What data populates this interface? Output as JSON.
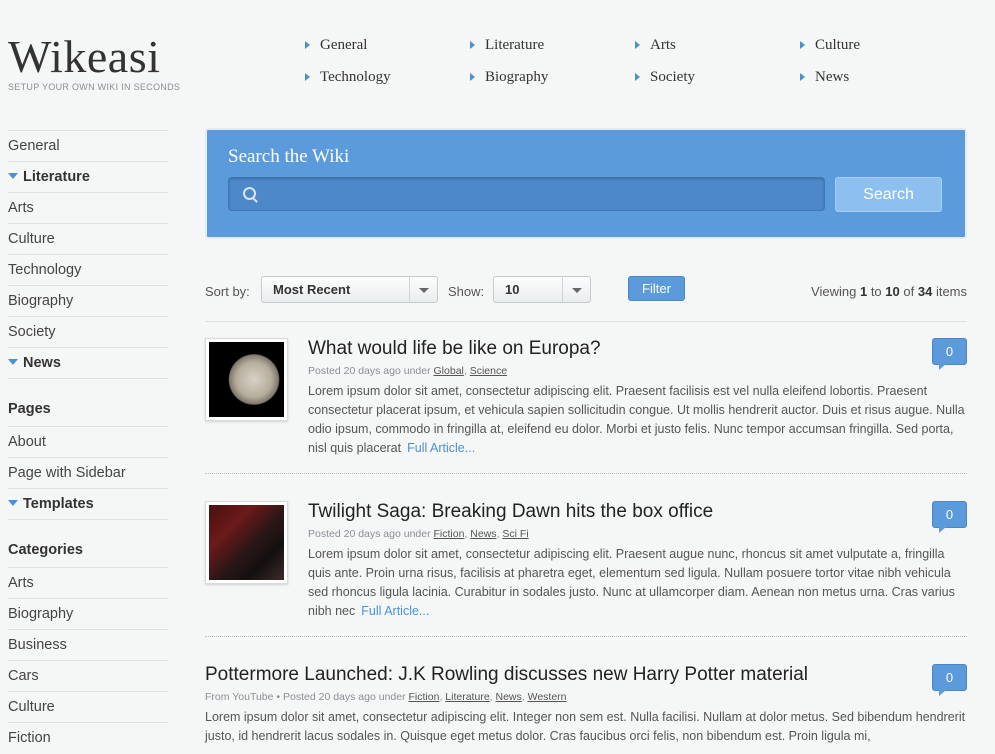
{
  "logo": {
    "title": "Wikeasi",
    "tagline": "SETUP YOUR OWN WIKI IN SECONDS"
  },
  "topnav": [
    {
      "label": "General"
    },
    {
      "label": "Literature"
    },
    {
      "label": "Arts"
    },
    {
      "label": "Culture"
    },
    {
      "label": "Technology"
    },
    {
      "label": "Biography"
    },
    {
      "label": "Society"
    },
    {
      "label": "News"
    }
  ],
  "sidebar": {
    "main_items": [
      "General",
      "Literature",
      "Arts",
      "Culture",
      "Technology",
      "Biography",
      "Society",
      "News"
    ],
    "pages_heading": "Pages",
    "pages_items": [
      "About",
      "Page with Sidebar",
      "Templates"
    ],
    "categories_heading": "Categories",
    "categories_items": [
      "Arts",
      "Biography",
      "Business",
      "Cars",
      "Culture",
      "Fiction"
    ]
  },
  "search": {
    "title": "Search the Wiki",
    "placeholder": "",
    "button_label": "Search"
  },
  "filter": {
    "sort_label": "Sort by:",
    "sort_value": "Most Recent",
    "show_label": "Show:",
    "show_value": "10",
    "button_label": "Filter",
    "viewing": {
      "prefix": "Viewing",
      "from": "1",
      "to_word": "to",
      "to": "10",
      "of_word": "of",
      "total": "34",
      "suffix": "items"
    }
  },
  "articles": [
    {
      "title": "What would life be like on Europa?",
      "meta_prefix": "Posted 20 days ago under",
      "tags": [
        "Global",
        "Science"
      ],
      "body": "Lorem ipsum dolor sit amet, consectetur adipiscing elit. Praesent facilisis est vel nulla eleifend lobortis. Praesent consectetur placerat ipsum, et vehicula sapien sollicitudin congue. Ut mollis hendrerit auctor. Duis et risus augue. Nulla odio ipsum, commodo in fringilla at, eleifend eu dolor. Morbi et justo felis. Nunc tempor accumsan fringilla. Sed porta, nisl quis placerat",
      "more": "Full Article...",
      "comments": "0"
    },
    {
      "title": "Twilight Saga: Breaking Dawn hits the box office",
      "meta_prefix": "Posted 20 days ago under",
      "tags": [
        "Fiction",
        "News",
        "Sci Fi"
      ],
      "body": "Lorem ipsum dolor sit amet, consectetur adipiscing elit. Praesent augue nunc, rhoncus sit amet vulputate a, fringilla quis ante. Proin urna risus, facilisis at pharetra eget, elementum sed ligula. Nullam posuere tortor vitae nibh vehicula sed rhoncus ligula lacinia. Curabitur in sodales justo. Nunc at ullamcorper diam. Aenean non metus urna. Cras varius nibh nec",
      "more": "Full Article...",
      "comments": "0"
    },
    {
      "title": "Pottermore Launched: J.K Rowling discusses new Harry Potter material",
      "meta_prefix": "From YouTube • Posted 20 days ago under",
      "tags": [
        "Fiction",
        "Literature",
        "News",
        "Western"
      ],
      "body": "Lorem ipsum dolor sit amet, consectetur adipiscing elit. Integer non sem est. Nulla facilisi. Nullam at dolor metus. Sed bibendum hendrerit justo, id hendrerit lacus sodales in. Quisque eget metus dolor. Cras faucibus orci felis, non bibendum est. Proin ligula mi,",
      "more": "",
      "comments": "0"
    }
  ]
}
